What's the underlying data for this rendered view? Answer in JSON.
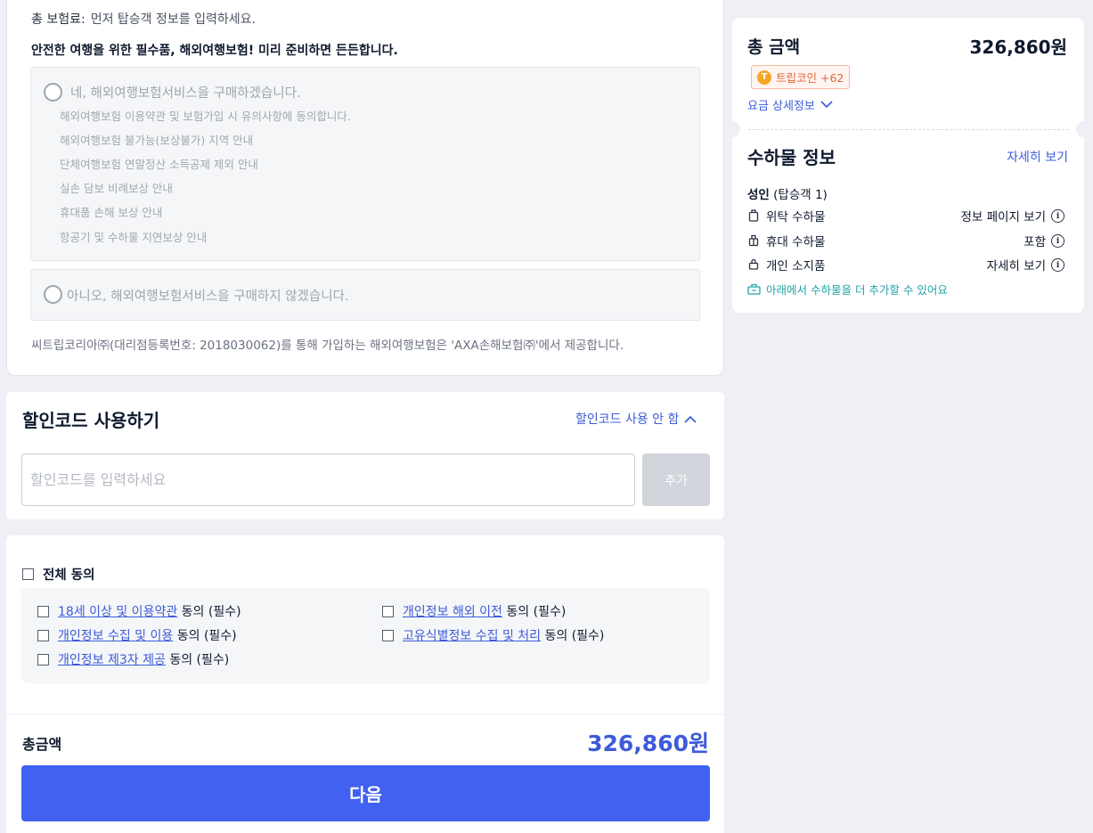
{
  "insurance": {
    "premium_label": "총 보험료:",
    "premium_value": "먼저 탑승객 정보를 입력하세요.",
    "headline": "안전한 여행을 위한 필수품, 해외여행보험! 미리 준비하면 든든합니다.",
    "option_yes": "네, 해외여행보험서비스을 구매하겠습니다.",
    "option_yes_items": [
      "해외여행보험 이용약관 및 보험가입 시 유의사항에 동의합니다.",
      "해외여행보험 불가능(보상불가) 지역 안내",
      "단체여행보험 연말정산 소득공제 제외 안내",
      "실손 담보 비례보상 안내",
      "휴대품 손해 보상 안내",
      "항공기 및 수하물 지연보상 안내"
    ],
    "option_no": "아니오, 해외여행보험서비스을 구매하지 않겠습니다.",
    "notice": "씨트립코리아㈜(대리점등록번호: 2018030062)를 통해 가입하는 해외여행보험은 'AXA손해보험㈜'에서 제공합니다."
  },
  "discount": {
    "title": "할인코드 사용하기",
    "toggle_label": "할인코드 사용 안 함",
    "input_placeholder": "할인코드를 입력하세요",
    "input_value": "",
    "add_button": "추가"
  },
  "agreement": {
    "all_label": "전체 동의",
    "items": [
      {
        "link": "18세 이상 및 이용약관",
        "suffix": "동의 (필수)"
      },
      {
        "link": "개인정보 해외 이전",
        "suffix": "동의 (필수)"
      },
      {
        "link": "개인정보 수집 및 이용",
        "suffix": "동의 (필수)"
      },
      {
        "link": "고유식별정보 수집 및 처리",
        "suffix": "동의 (필수)"
      },
      {
        "link": "개인정보 제3자 제공",
        "suffix": "동의 (필수)"
      }
    ],
    "total_label": "총금액",
    "total_value": "326,860원",
    "next_button": "다음"
  },
  "sidebar": {
    "total_label": "총 금액",
    "total_value": "326,860원",
    "coin_icon_letter": "T",
    "coin_label": "트립코인 +62",
    "fare_detail": "요금 상세정보",
    "baggage_title": "수하물 정보",
    "baggage_more": "자세히 보기",
    "passenger_type": "성인",
    "passenger_note": "(탑승객 1)",
    "baggage_rows": [
      {
        "icon": "checked-baggage-icon",
        "label": "위탁 수하물",
        "value": "정보 페이지 보기"
      },
      {
        "icon": "carry-on-icon",
        "label": "휴대 수하물",
        "value": "포함"
      },
      {
        "icon": "personal-item-icon",
        "label": "개인 소지품",
        "value": "자세히 보기"
      }
    ],
    "baggage_add_note": "아래에서 수하물을 더 추가할 수 있어요"
  },
  "colors": {
    "accent": "#3d5bd9",
    "button": "#4261f0",
    "coin": "#e0663a",
    "teal": "#21a3a8"
  }
}
